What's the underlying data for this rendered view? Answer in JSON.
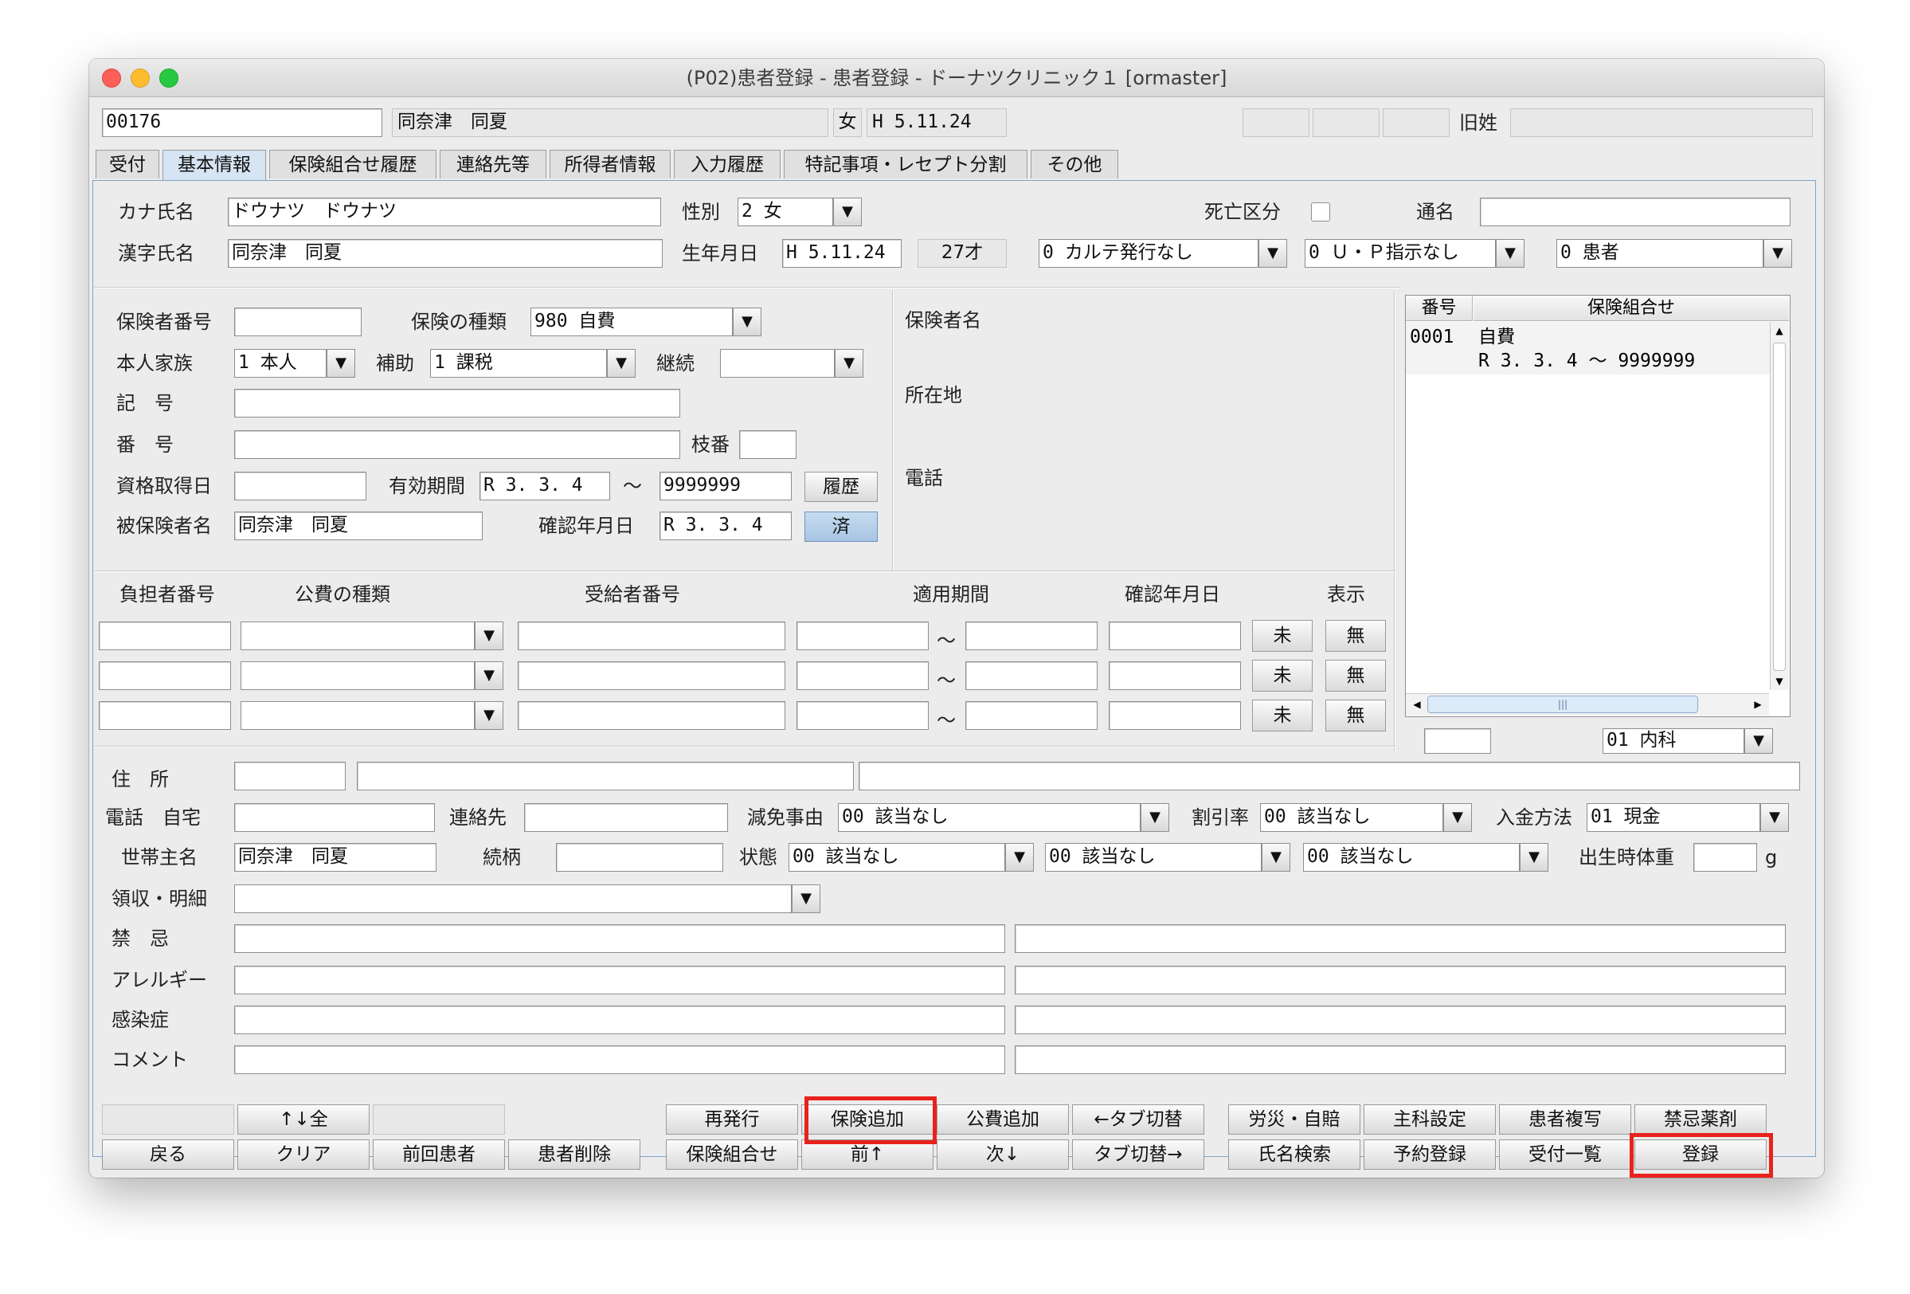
{
  "window": {
    "title": "(P02)患者登録 - 患者登録 - ドーナツクリニック１ [ormaster]"
  },
  "header": {
    "patient_id": "00176",
    "patient_name": "同奈津　同夏",
    "sex": "女",
    "birthdate": "H 5.11.24",
    "former_name_label": "旧姓"
  },
  "tabs": [
    "受付",
    "基本情報",
    "保険組合せ履歴",
    "連絡先等",
    "所得者情報",
    "入力履歴",
    "特記事項・レセプト分割",
    "その他"
  ],
  "basic": {
    "kana_label": "カナ氏名",
    "kana_value": "ドウナツ　ドウナツ",
    "kanji_label": "漢字氏名",
    "kanji_value": "同奈津　同夏",
    "sex_label": "性別",
    "sex_value": "2 女",
    "birth_label": "生年月日",
    "birth_value": "H 5.11.24",
    "age": "27才",
    "death_label": "死亡区分",
    "alias_label": "通名",
    "karte_value": "0 カルテ発行なし",
    "up_value": "0 Ｕ・Ｐ指示なし",
    "patient_kind_value": "0 患者"
  },
  "insurance": {
    "insurer_no_label": "保険者番号",
    "kind_label": "保険の種類",
    "kind_value": "980 自費",
    "family_label": "本人家族",
    "family_value": "1 本人",
    "aid_label": "補助",
    "aid_value": "1 課税",
    "continue_label": "継続",
    "symbol_label": "記　号",
    "number_label": "番　号",
    "branch_label": "枝番",
    "qualify_label": "資格取得日",
    "valid_label": "有効期間",
    "valid_from": "R 3. 3. 4",
    "tilde": "～",
    "valid_to": "9999999",
    "history_button": "履歴",
    "insured_label": "被保険者名",
    "insured_value": "同奈津　同夏",
    "confirm_label": "確認年月日",
    "confirm_value": "R 3. 3. 4",
    "done_button": "済",
    "insurer_name_label": "保険者名",
    "address_label": "所在地",
    "phone_label": "電話"
  },
  "combo": {
    "col_no": "番号",
    "col_combo": "保険組合せ",
    "row_no": "0001",
    "row_name": "自費",
    "row_period": "R 3. 3. 4 ～ 9999999",
    "dept_value": "01 内科"
  },
  "public": {
    "col_burden": "負担者番号",
    "col_kind": "公費の種類",
    "col_recipient": "受給者番号",
    "col_period": "適用期間",
    "col_confirm": "確認年月日",
    "col_display": "表示",
    "tilde": "～",
    "btn_mi": "未",
    "btn_mu": "無"
  },
  "contact": {
    "address_label": "住　所",
    "phone_label": "電話　自宅",
    "contact_label": "連絡先",
    "reduce_label": "減免事由",
    "reduce_value": "00 該当なし",
    "discount_label": "割引率",
    "discount_value": "00 該当なし",
    "payment_label": "入金方法",
    "payment_value": "01 現金",
    "head_label": "世帯主名",
    "head_value": "同奈津　同夏",
    "relation_label": "続柄",
    "state_label": "状態",
    "state1": "00 該当なし",
    "state2": "00 該当なし",
    "state3": "00 該当なし",
    "birth_weight_label": "出生時体重",
    "gram": "g",
    "receipt_label": "領収・明細",
    "taboo_label": "禁　忌",
    "allergy_label": "アレルギー",
    "infection_label": "感染症",
    "comment_label": "コメント"
  },
  "footer": {
    "btn_all": "↑↓全",
    "btn_reissue": "再発行",
    "btn_add_ins": "保険追加",
    "btn_add_pub": "公費追加",
    "btn_tab_back": "←タブ切替",
    "btn_rousai": "労災・自賠",
    "btn_dept": "主科設定",
    "btn_copy": "患者複写",
    "btn_drug": "禁忌薬剤",
    "btn_back": "戻る",
    "btn_clear": "クリア",
    "btn_prev_patient": "前回患者",
    "btn_delete": "患者削除",
    "btn_combo": "保険組合せ",
    "btn_prev": "前↑",
    "btn_next": "次↓",
    "btn_tab_next": "タブ切替→",
    "btn_search": "氏名検索",
    "btn_reserve": "予約登録",
    "btn_list": "受付一覧",
    "btn_register": "登録"
  },
  "colors": {
    "highlight": "#e8221c",
    "tab_selected": "#d6e4f3",
    "panel_border": "#7ea3ca"
  }
}
